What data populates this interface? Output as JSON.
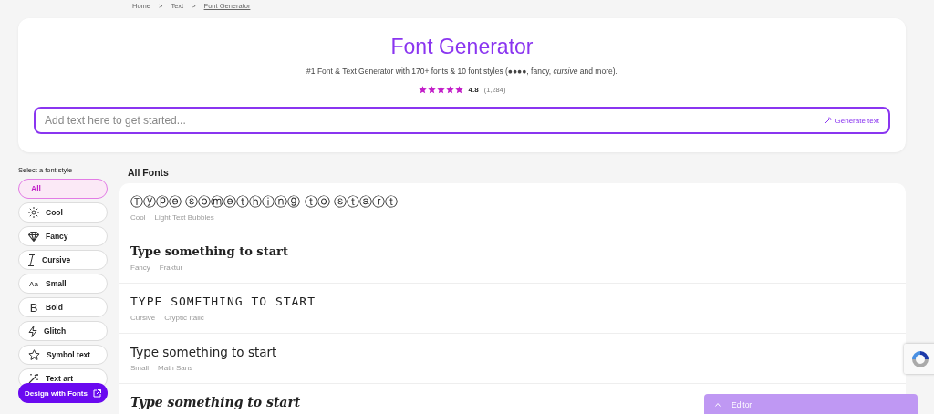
{
  "breadcrumb": [
    {
      "label": "Home",
      "current": false
    },
    {
      "label": "Text",
      "current": false
    },
    {
      "label": "Font Generator",
      "current": true
    }
  ],
  "breadcrumb_separator": ">",
  "header": {
    "title": "Font Generator",
    "subtitle": "#1 Font & Text Generator with 170+ fonts & 10 font styles (●●●●, fancy, *cursive* and more).",
    "rating": {
      "stars": 5,
      "value": "4.8",
      "count": "(1,284)"
    },
    "input": {
      "placeholder": "Add text here to get started..."
    },
    "generate_button": "Generate text"
  },
  "sidebar": {
    "title": "Select a font style",
    "items": [
      {
        "label": "All",
        "kind": "none",
        "selected": true
      },
      {
        "label": "Cool",
        "kind": "sparkle",
        "selected": false
      },
      {
        "label": "Fancy",
        "kind": "diamond",
        "selected": false
      },
      {
        "label": "Cursive",
        "kind": "cursor",
        "selected": false
      },
      {
        "label": "Small",
        "kind": "text",
        "icon_text": "Aa",
        "selected": false
      },
      {
        "label": "Bold",
        "kind": "text",
        "icon_text": "B",
        "selected": false
      },
      {
        "label": "Glitch",
        "kind": "bolt",
        "selected": false
      },
      {
        "label": "Symbol text",
        "kind": "star",
        "selected": false
      },
      {
        "label": "Text art",
        "kind": "wand",
        "selected": false
      }
    ],
    "cta": "Design with Fonts"
  },
  "fonts": {
    "title": "All Fonts",
    "rows": [
      {
        "sample": "Ⓣⓨⓟⓔ ⓢⓞⓜⓔⓣⓗⓘⓝⓖ ⓣⓞ ⓢⓣⓐⓡⓣ",
        "kind": "bubbles",
        "category": "Cool",
        "font": "Light Text Bubbles"
      },
      {
        "sample": "Type something to start",
        "kind": "fraktur",
        "category": "Fancy",
        "font": "Fraktur"
      },
      {
        "sample": "TYPE SOMETHING TO START",
        "kind": "cryptic",
        "category": "Cursive",
        "font": "Cryptic Italic"
      },
      {
        "sample": "Type something to start",
        "kind": "sans",
        "category": "Small",
        "font": "Math Sans"
      },
      {
        "sample": "Type something to start",
        "kind": "script",
        "category": "",
        "font": ""
      }
    ]
  },
  "editor": {
    "label": "Editor",
    "expanded": false
  }
}
